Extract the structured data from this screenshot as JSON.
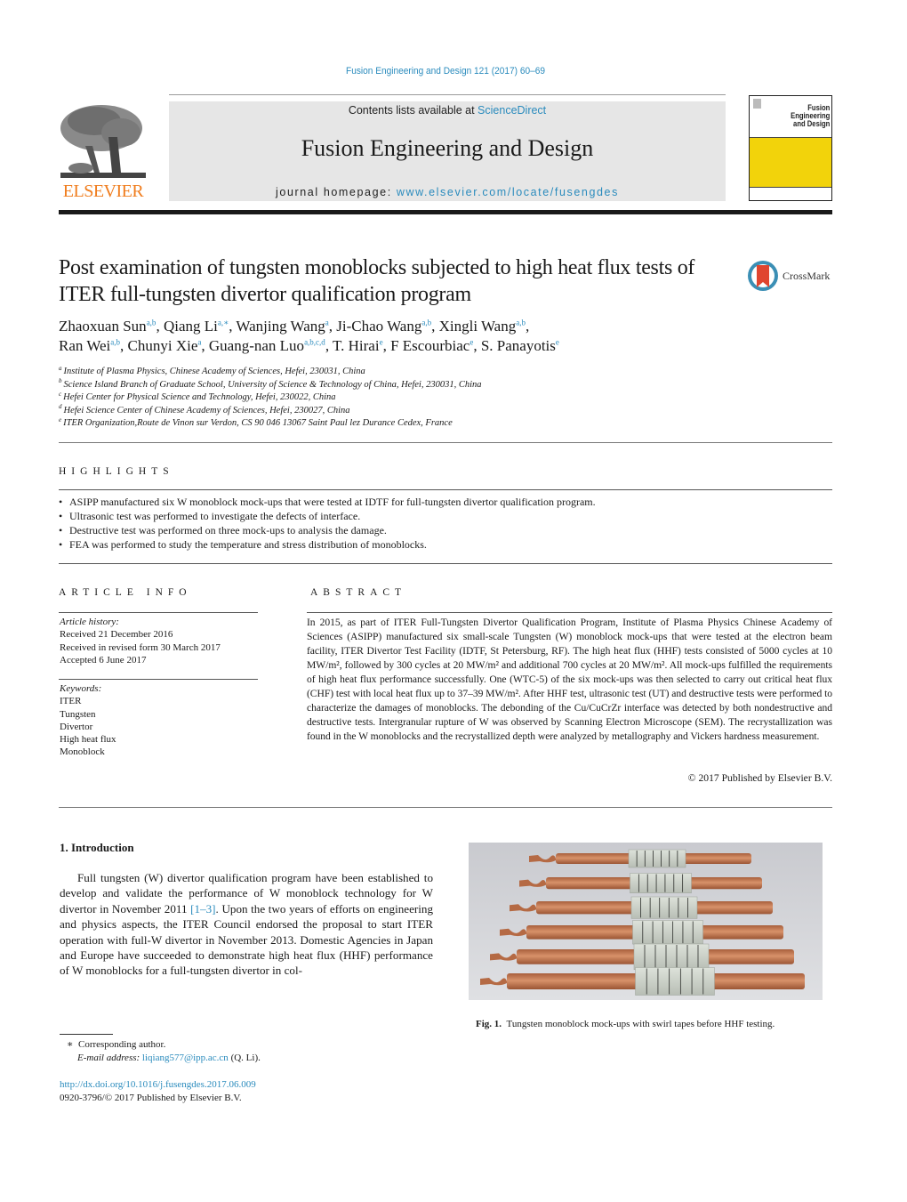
{
  "header": {
    "journal_ref": "Fusion Engineering and Design 121 (2017) 60–69",
    "contents_prefix": "Contents lists available at ",
    "contents_link": "ScienceDirect",
    "journal_title": "Fusion Engineering and Design",
    "homepage_prefix": "journal homepage: ",
    "homepage_link": "www.elsevier.com/locate/fusengdes",
    "publisher_logo_text": "ELSEVIER",
    "publisher_logo_color": "#f07d1e",
    "cover_title": "Fusion Engineering and Design",
    "cover_color": "#f2d30b"
  },
  "article": {
    "title": "Post examination of tungsten monoblocks subjected to high heat flux tests of ITER full-tungsten divertor qualification program",
    "crossmark_label": "CrossMark",
    "authors": [
      {
        "name": "Zhaoxuan Sun",
        "aff": "a,b"
      },
      {
        "name": "Qiang Li",
        "aff": "a,∗"
      },
      {
        "name": "Wanjing Wang",
        "aff": "a"
      },
      {
        "name": "Ji-Chao Wang",
        "aff": "a,b"
      },
      {
        "name": "Xingli Wang",
        "aff": "a,b"
      },
      {
        "name": "Ran Wei",
        "aff": "a,b"
      },
      {
        "name": "Chunyi Xie",
        "aff": "a"
      },
      {
        "name": "Guang-nan Luo",
        "aff": "a,b,c,d"
      },
      {
        "name": "T. Hirai",
        "aff": "e"
      },
      {
        "name": "F Escourbiac",
        "aff": "e"
      },
      {
        "name": "S. Panayotis",
        "aff": "e"
      }
    ],
    "affiliations": [
      {
        "key": "a",
        "text": "Institute of Plasma Physics, Chinese Academy of Sciences, Hefei, 230031, China"
      },
      {
        "key": "b",
        "text": "Science Island Branch of Graduate School, University of Science & Technology of China, Hefei, 230031, China"
      },
      {
        "key": "c",
        "text": "Hefei Center for Physical Science and Technology, Hefei, 230022, China"
      },
      {
        "key": "d",
        "text": "Hefei Science Center of Chinese Academy of Sciences, Hefei, 230027, China"
      },
      {
        "key": "e",
        "text": "ITER Organization,Route de Vinon sur Verdon, CS 90 046 13067 Saint Paul lez Durance Cedex, France"
      }
    ]
  },
  "highlights": {
    "label": "HIGHLIGHTS",
    "items": [
      "ASIPP manufactured six W monoblock mock-ups that were tested at IDTF for full-tungsten divertor qualification program.",
      "Ultrasonic test was performed to investigate the defects of interface.",
      "Destructive test was performed on three mock-ups to analysis the damage.",
      "FEA was performed to study the temperature and stress distribution of monoblocks."
    ]
  },
  "article_info": {
    "label": "ARTICLE INFO",
    "history_label": "Article history:",
    "history": [
      "Received 21 December 2016",
      "Received in revised form 30 March 2017",
      "Accepted 6 June 2017"
    ],
    "keywords_label": "Keywords:",
    "keywords": [
      "ITER",
      "Tungsten",
      "Divertor",
      "High heat flux",
      "Monoblock"
    ]
  },
  "abstract": {
    "label": "ABSTRACT",
    "text": "In 2015, as part of ITER Full-Tungsten Divertor Qualification Program, Institute of Plasma Physics Chinese Academy of Sciences (ASIPP) manufactured six small-scale Tungsten (W) monoblock mock-ups that were tested at the electron beam facility, ITER Divertor Test Facility (IDTF, St Petersburg, RF). The high heat flux (HHF) tests consisted of 5000 cycles at 10 MW/m², followed by 300 cycles at 20 MW/m² and additional 700 cycles at 20 MW/m². All mock-ups fulfilled the requirements of high heat flux performance successfully. One (WTC-5) of the six mock-ups was then selected to carry out critical heat flux (CHF) test with local heat flux up to 37–39 MW/m². After HHF test, ultrasonic test (UT) and destructive tests were performed to characterize the damages of monoblocks. The debonding of the Cu/CuCrZr interface was detected by both nondestructive and destructive tests. Intergranular rupture of W was observed by Scanning Electron Microscope (SEM). The recrystallization was found in the W monoblocks and the recrystallized depth were analyzed by metallography and Vickers hardness measurement.",
    "copyright": "© 2017 Published by Elsevier B.V."
  },
  "introduction": {
    "heading": "1.  Introduction",
    "text_before_ref": "Full tungsten (W) divertor qualification program have been established to develop and validate the performance of W monoblock technology for W divertor in November 2011 ",
    "ref": "[1–3]",
    "text_after_ref": ". Upon the two years of efforts on engineering and physics aspects, the ITER Council endorsed the proposal to start ITER operation with full-W divertor in November 2013. Domestic Agencies in Japan and Europe have succeeded to demonstrate high heat flux (HHF) performance of W monoblocks for a full-tungsten divertor in col-"
  },
  "figure": {
    "label": "Fig. 1.",
    "caption": "Tungsten monoblock mock-ups with swirl tapes before HHF testing.",
    "mockup_count": 6,
    "copper_color": "#c07a52",
    "tungsten_color": "#c9cfc6"
  },
  "footnotes": {
    "corresponding_mark": "∗",
    "corresponding_text": "Corresponding author.",
    "email_label": "E-mail address:",
    "email": "liqiang577@ipp.ac.cn",
    "email_suffix": " (Q. Li).",
    "doi": "http://dx.doi.org/10.1016/j.fusengdes.2017.06.009",
    "issn_line": "0920-3796/© 2017 Published by Elsevier B.V."
  }
}
